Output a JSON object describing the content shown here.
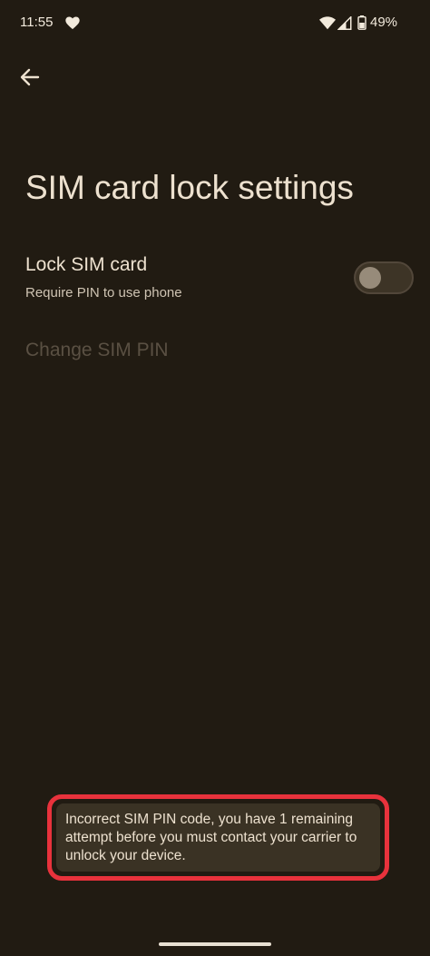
{
  "status_bar": {
    "time": "11:55",
    "battery": "49%",
    "icons": [
      "heart-icon",
      "wifi-icon",
      "signal-icon",
      "battery-icon"
    ]
  },
  "header": {
    "back_icon": "arrow-left-icon",
    "title": "SIM card lock settings"
  },
  "settings": {
    "lock_sim": {
      "title": "Lock SIM card",
      "summary": "Require PIN to use phone",
      "enabled": false
    },
    "change_pin": {
      "title": "Change SIM PIN",
      "enabled": false
    }
  },
  "toast": {
    "message": "Incorrect SIM PIN code, you have 1 remaining attempt before you must contact your carrier to unlock your device."
  },
  "colors": {
    "background": "#211b12",
    "text_primary": "#ede1cf",
    "text_disabled": "#5a5043",
    "highlight": "#e8323c",
    "toast_bg": "#3a3224"
  }
}
